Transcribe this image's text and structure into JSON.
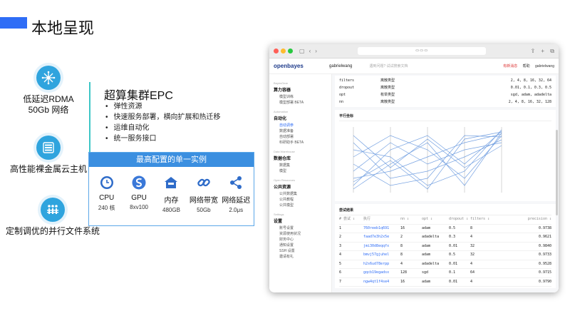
{
  "slide_title": "本地呈现",
  "features": [
    {
      "icon": "network-hub-icon",
      "line1": "低延迟RDMA",
      "line2": "50Gb 网络"
    },
    {
      "icon": "server-rack-icon",
      "line1": "高性能裸金属云主机",
      "line2": ""
    },
    {
      "icon": "file-system-icon",
      "line1": "定制调优的并行文件系统",
      "line2": ""
    }
  ],
  "epc": {
    "title": "超算集群EPC",
    "bullets": [
      "弹性资源",
      "快速服务部署，横向扩展和热迁移",
      "运维自动化",
      "统一服务接口"
    ]
  },
  "config": {
    "header": "最高配置的单一实例",
    "specs": [
      {
        "icon": "clock-icon",
        "name": "CPU",
        "value": "240 核"
      },
      {
        "icon": "gpu-s-icon",
        "name": "GPU",
        "value": "8xv100"
      },
      {
        "icon": "memory-house-icon",
        "name": "内存",
        "value": "480GB"
      },
      {
        "icon": "link-icon",
        "name": "网络带宽",
        "value": "50Gb"
      },
      {
        "icon": "share-icon",
        "name": "网络延迟",
        "value": "2.0μs"
      }
    ]
  },
  "browser": {
    "brand": "openbayes",
    "user": "gabrielwang",
    "search_placeholder": "遇到问题? 试试搜索文档",
    "top_links": [
      "有新消息",
      "帮助",
      "gabrielwang"
    ],
    "sidebar": [
      {
        "caption": "BayesGear",
        "head": "算力容器",
        "items": [
          "模型训练",
          "模型部署 BETA"
        ],
        "active": -1
      },
      {
        "caption": "Automation",
        "head": "自动化",
        "items": [
          "自动调参",
          "数据准备",
          "自动部署",
          "科研助手 BETA"
        ],
        "active": 0
      },
      {
        "caption": "Data Warehouse",
        "head": "数据仓库",
        "items": [
          "数据集",
          "模型"
        ],
        "active": -1
      },
      {
        "caption": "Open Resources",
        "head": "公共资源",
        "items": [
          "公共数据集",
          "公共教程",
          "公共模型"
        ],
        "active": -1
      },
      {
        "caption": "Settings",
        "head": "设置",
        "items": [
          "账号设置",
          "资源使用状况",
          "财务中心",
          "通知设置",
          "SSH 设置",
          "邀请有礼"
        ],
        "active": -1
      }
    ],
    "hyperparams": [
      {
        "name": "filters",
        "type": "离散类型",
        "values": "2, 4, 8, 16, 32, 64"
      },
      {
        "name": "dropout",
        "type": "离散类型",
        "values": "0.01, 0.1, 0.3, 0.5"
      },
      {
        "name": "opt",
        "type": "枚举类型",
        "values": "sgd, adam, adadelta"
      },
      {
        "name": "nn",
        "type": "离散类型",
        "values": "2, 4, 8, 16, 32, 128"
      }
    ],
    "parallel_title": "平行坐标",
    "results_title": "尝试结果",
    "results_headers": [
      "# 尝试 ⇕",
      "执行",
      "nn ⇕",
      "opt ⇕",
      "dropout ⇕",
      "filters ⇕",
      "precision ⇕"
    ],
    "results": [
      [
        "1",
        "760reeb1q691",
        "16",
        "adam",
        "0.5",
        "8",
        "0.9738"
      ],
      [
        "2",
        "faad7e3h2x5e",
        "2",
        "adadelta",
        "0.3",
        "4",
        "0.9621"
      ],
      [
        "3",
        "jmi30d8eqqfx",
        "8",
        "adam",
        "0.01",
        "32",
        "0.9840"
      ],
      [
        "4",
        "bmvj57gjuhel",
        "8",
        "adam",
        "0.5",
        "32",
        "0.9733"
      ],
      [
        "5",
        "h2s6ud78erpp",
        "4",
        "adadelta",
        "0.01",
        "4",
        "0.9528"
      ],
      [
        "6",
        "gqcb19egadsx",
        "128",
        "sgd",
        "0.1",
        "64",
        "0.9715"
      ],
      [
        "7",
        "ngw4qt1f4se4",
        "16",
        "adam",
        "0.01",
        "4",
        "0.9790"
      ]
    ]
  }
}
